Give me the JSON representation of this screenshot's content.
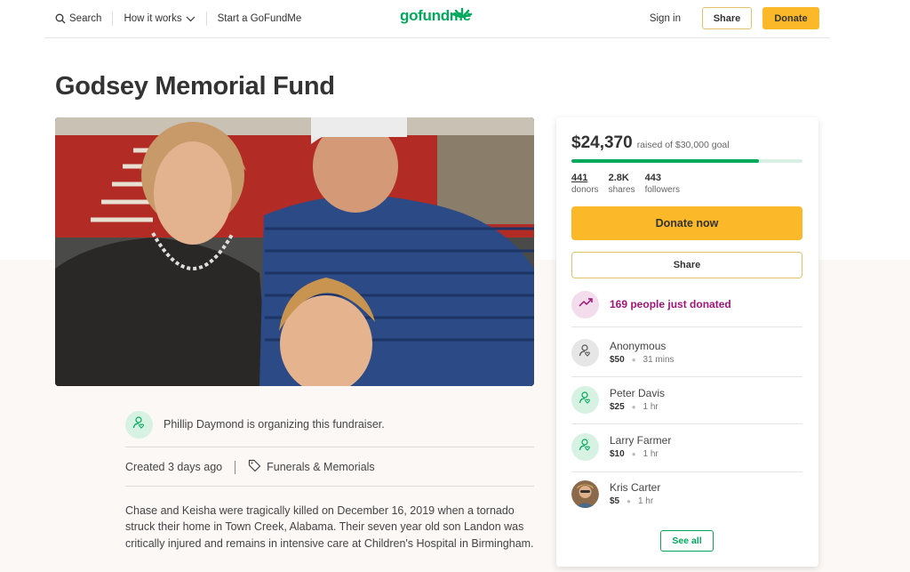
{
  "header": {
    "search_label": "Search",
    "how_it_works_label": "How it works",
    "start_label": "Start a GoFundMe",
    "logo_text": "gofundme",
    "signin_label": "Sign in",
    "share_label": "Share",
    "donate_label": "Donate"
  },
  "page": {
    "title": "Godsey Memorial Fund"
  },
  "organizer": {
    "text": "Phillip Daymond is organizing this fundraiser."
  },
  "meta": {
    "created": "Created 3 days ago",
    "category": "Funerals & Memorials"
  },
  "story": "Chase and Keisha were tragically killed on December 16, 2019 when a tornado struck their home in Town Creek, Alabama. Their seven year old son Landon was critically injured and remains in intensive care at Children's Hospital in Birmingham.",
  "sidebar": {
    "amount": "$24,370",
    "goal_text": "raised of $30,000 goal",
    "progress_fraction": 0.812,
    "stats": [
      {
        "value": "441",
        "label": "donors"
      },
      {
        "value": "2.8K",
        "label": "shares"
      },
      {
        "value": "443",
        "label": "followers"
      }
    ],
    "donate_now_label": "Donate now",
    "share_label": "Share",
    "trend_text": "169 people just donated",
    "donations": [
      {
        "name": "Anonymous",
        "amount": "$50",
        "time": "31 mins",
        "avatar": "user-icon-gray"
      },
      {
        "name": "Peter Davis",
        "amount": "$25",
        "time": "1 hr",
        "avatar": "user-icon-green"
      },
      {
        "name": "Larry Farmer",
        "amount": "$10",
        "time": "1 hr",
        "avatar": "user-icon-green"
      },
      {
        "name": "Kris Carter",
        "amount": "$5",
        "time": "1 hr",
        "avatar": "photo"
      }
    ],
    "see_all_label": "See all"
  },
  "colors": {
    "brand_green": "#02a95c",
    "donate_yellow": "#fbb829",
    "trend_purple": "#a01478"
  }
}
